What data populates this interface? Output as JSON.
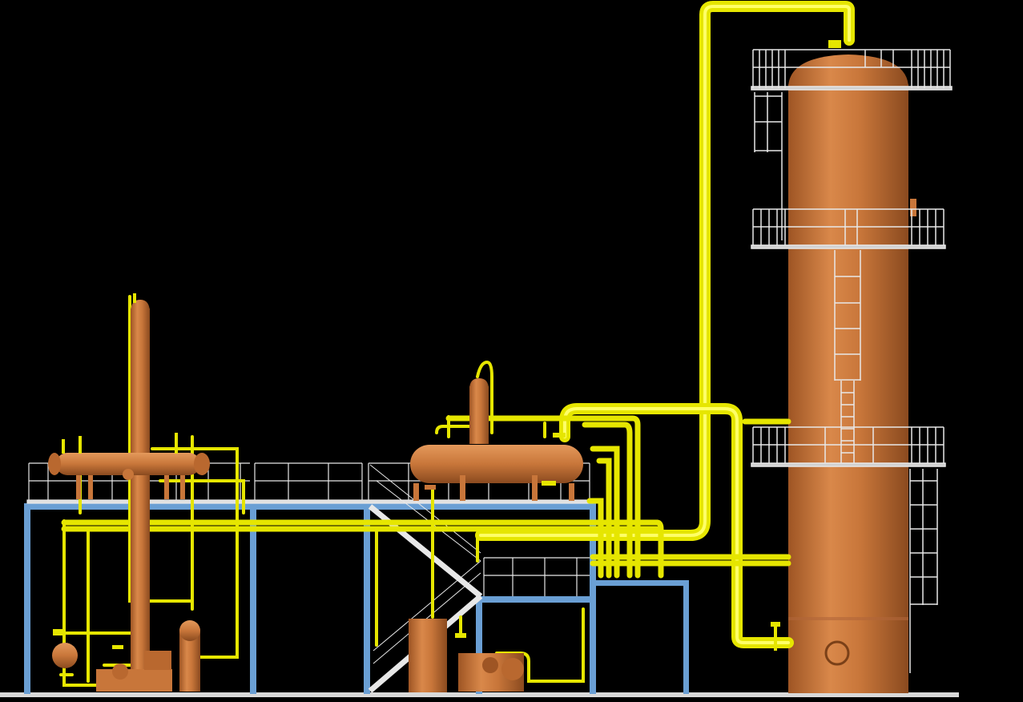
{
  "view": {
    "background": "#000000",
    "description_visible_text": ""
  },
  "palette": {
    "vessel": "#c8763a",
    "vessel_shade": "#9e5524",
    "vessel_light": "#e4995b",
    "pipe": "#e6e600",
    "pipe_shade": "#a8a800",
    "steel": "#6a9fd4",
    "railing": "#e8e8e8",
    "ground": "#d9d9d9"
  },
  "equipment": [
    {
      "id": "main-column",
      "kind": "tower"
    },
    {
      "id": "small-column",
      "kind": "tower"
    },
    {
      "id": "drum-left",
      "kind": "horizontal-vessel"
    },
    {
      "id": "drum-center",
      "kind": "horizontal-vessel"
    },
    {
      "id": "reflux-drum-vertical",
      "kind": "vertical-vessel"
    },
    {
      "id": "pump-left",
      "kind": "pump"
    },
    {
      "id": "pump-center",
      "kind": "pump"
    }
  ]
}
